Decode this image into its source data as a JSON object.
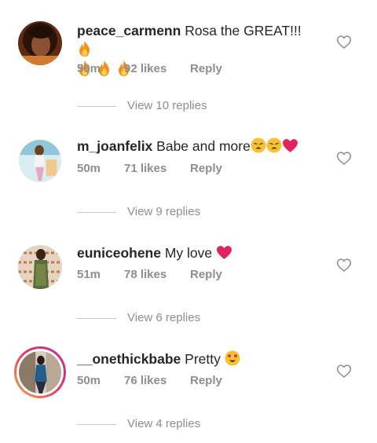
{
  "comments": [
    {
      "username": "peace_carmenn",
      "text": "Rosa the GREAT!!!",
      "emojis": [
        "fire-emoji",
        "fire-emoji",
        "fire-emoji",
        "fire-emoji"
      ],
      "time": "50m",
      "likes": "92 likes",
      "reply_label": "Reply",
      "view_replies": "View 10 replies"
    },
    {
      "username": "m_joanfelix",
      "text": "Babe and more",
      "emojis": [
        "weary-face-emoji",
        "weary-face-emoji",
        "red-heart-emoji"
      ],
      "time": "50m",
      "likes": "71 likes",
      "reply_label": "Reply",
      "view_replies": "View 9 replies"
    },
    {
      "username": "euniceohene",
      "text": "My love",
      "emojis": [
        "red-heart-emoji"
      ],
      "time": "51m",
      "likes": "78 likes",
      "reply_label": "Reply",
      "view_replies": "View 6 replies"
    },
    {
      "username": "__onethickbabe",
      "text": "Pretty",
      "emojis": [
        "heart-eyes-emoji"
      ],
      "time": "50m",
      "likes": "76 likes",
      "reply_label": "Reply",
      "view_replies": "View 4 replies"
    }
  ],
  "colors": {
    "text": "#262626",
    "secondary": "#8e8e8e",
    "divider": "#c7c7c7",
    "heart_red": "#e0245e",
    "story_ring_start": "#f5a53c",
    "story_ring_end": "#b92f9c"
  },
  "icons": {
    "like": "heart-outline-icon"
  }
}
